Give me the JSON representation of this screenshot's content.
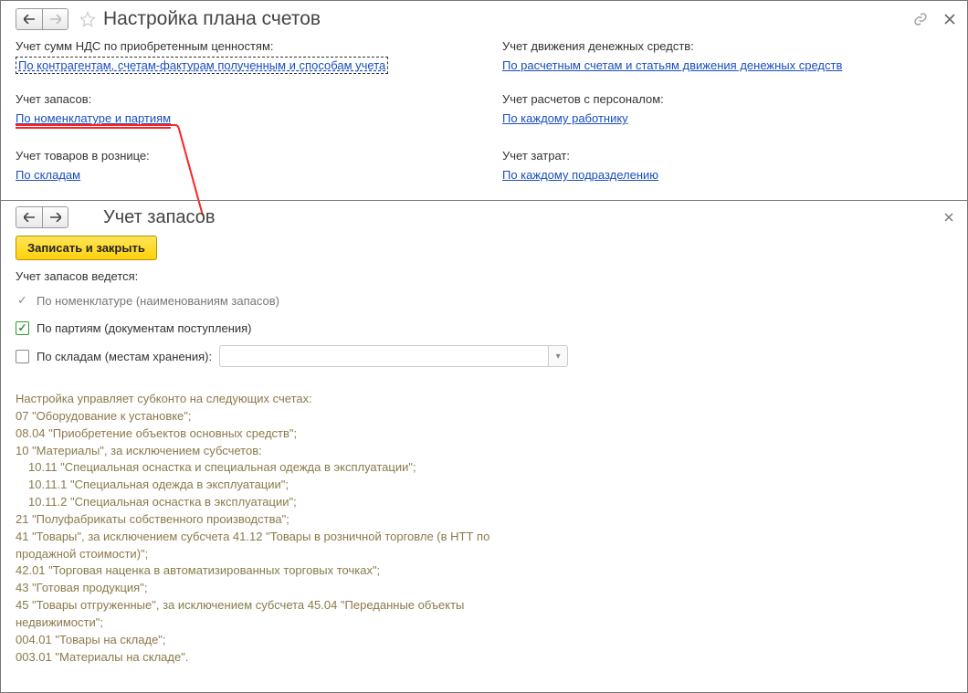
{
  "header": {
    "title": "Настройка плана счетов"
  },
  "settings": {
    "nds_label": "Учет сумм НДС по приобретенным ценностям:",
    "nds_link": "По контрагентам, счетам-фактурам полученным и способам учета",
    "money_label": "Учет движения денежных средств:",
    "money_link": "По расчетным счетам и статьям движения денежных средств",
    "stock_label": "Учет запасов:",
    "stock_link": "По номенклатуре и партиям",
    "staff_label": "Учет расчетов с персоналом:",
    "staff_link": "По каждому работнику",
    "retail_label": "Учет товаров в рознице:",
    "retail_link": "По складам",
    "costs_label": "Учет затрат:",
    "costs_link": "По каждому подразделению"
  },
  "subwindow": {
    "title": "Учет запасов",
    "save_btn": "Записать и закрыть",
    "accounting_label": "Учет запасов ведется:",
    "opt_nomenclature": "По номенклатуре (наименованиям запасов)",
    "opt_batches": "По партиям (документам поступления)",
    "opt_warehouses": "По складам (местам хранения):"
  },
  "description": {
    "intro": "Настройка управляет субконто на следующих счетах:",
    "l1": "07 \"Оборудование к установке\";",
    "l2": "08.04 \"Приобретение объектов основных средств\";",
    "l3": "10 \"Материалы\", за исключением субсчетов:",
    "l4": "10.11 \"Специальная оснастка и специальная одежда в эксплуатации\";",
    "l5": "10.11.1 \"Специальная одежда в эксплуатации\";",
    "l6": "10.11.2 \"Специальная оснастка в эксплуатации\";",
    "l7": "21 \"Полуфабрикаты собственного производства\";",
    "l8": "41 \"Товары\", за исключением субсчета 41.12 \"Товары в розничной торговле (в НТТ по продажной стоимости)\";",
    "l9": "42.01 \"Торговая наценка в автоматизированных торговых точках\";",
    "l10": "43 \"Готовая продукция\";",
    "l11": "45 \"Товары отгруженные\", за исключением субсчета 45.04 \"Переданные объекты недвижимости\";",
    "l12": "004.01 \"Товары на складе\";",
    "l13": "003.01 \"Материалы на складе\"."
  }
}
